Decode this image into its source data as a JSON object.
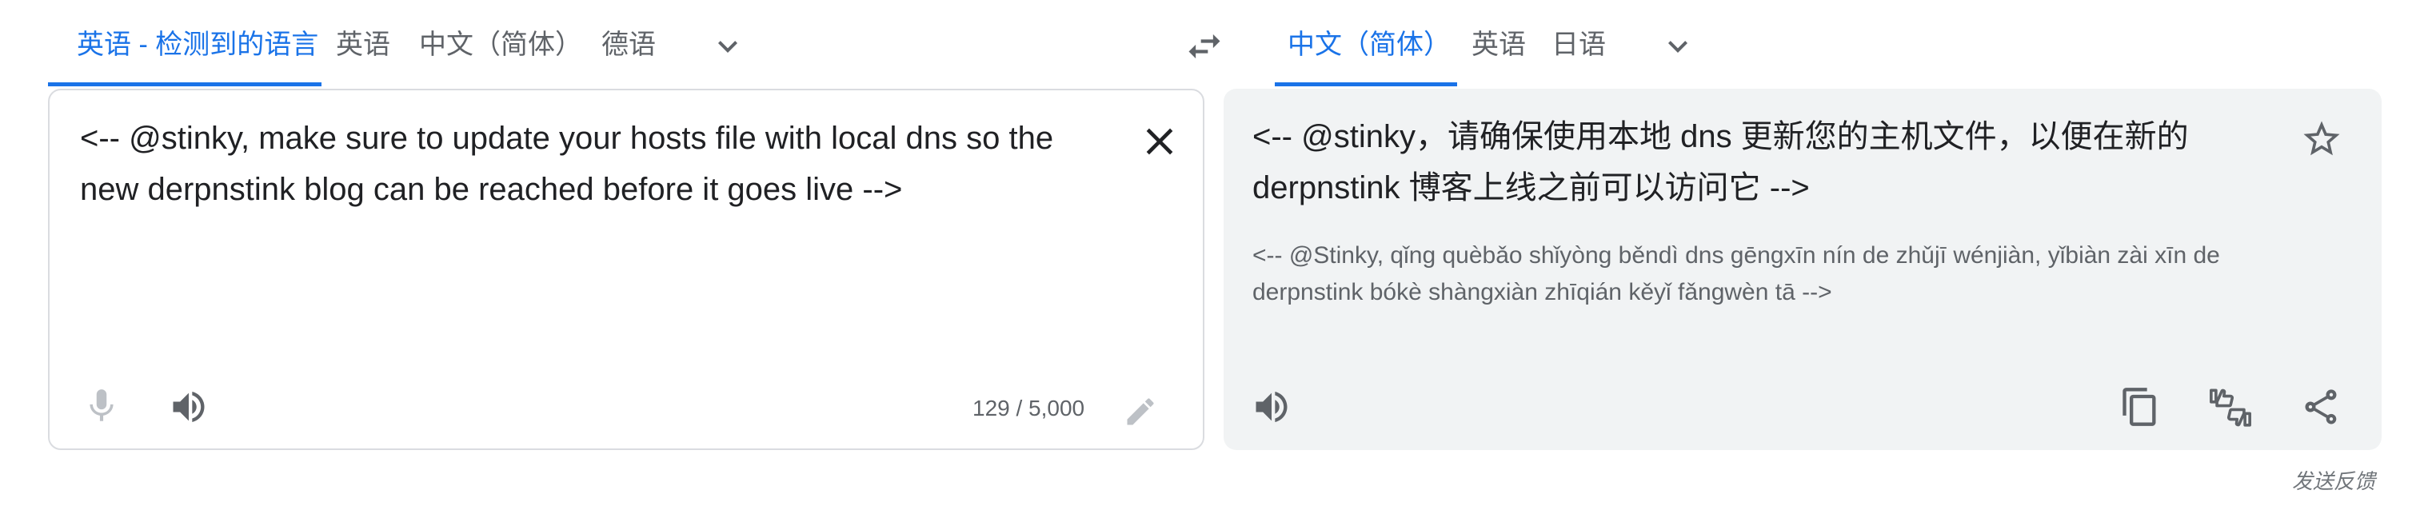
{
  "source_tabs": [
    {
      "label": "英语 - 检测到的语言",
      "active": true
    },
    {
      "label": "英语",
      "active": false
    },
    {
      "label": "中文（简体）",
      "active": false
    },
    {
      "label": "德语",
      "active": false
    }
  ],
  "target_tabs": [
    {
      "label": "中文（简体）",
      "active": true
    },
    {
      "label": "英语",
      "active": false
    },
    {
      "label": "日语",
      "active": false
    }
  ],
  "icons": {
    "more_source_languages": "chevron-down-icon",
    "swap": "swap-languages-icon",
    "more_target_languages": "chevron-down-icon",
    "clear": "close-icon",
    "mic": "microphone-icon",
    "listen_source": "speaker-icon",
    "edit": "pencil-icon",
    "save": "star-icon",
    "listen_target": "speaker-icon",
    "copy": "copy-icon",
    "rate": "thumbs-up-down-icon",
    "share": "share-icon"
  },
  "source": {
    "text": "<-- @stinky, make sure to update your hosts file with local dns so the new derpnstink blog can be reached before it goes live -->",
    "char_count": "129 / 5,000"
  },
  "target": {
    "text": "<-- @stinky，请确保使用本地 dns 更新您的主机文件，以便在新的 derpnstink 博客上线之前可以访问它 -->",
    "romanization": "<-- @Stinky, qǐng quèbǎo shǐyòng běndì dns gēngxīn nín de zhǔjī wénjiàn, yǐbiàn zài xīn de derpnstink bókè shàngxiàn zhīqián kěyǐ fǎngwèn tā -->"
  },
  "colors": {
    "accent": "#1a73e8",
    "target_bg": "#f1f3f4",
    "muted": "#5f6368"
  },
  "footer": {
    "feedback": "发送反馈"
  }
}
